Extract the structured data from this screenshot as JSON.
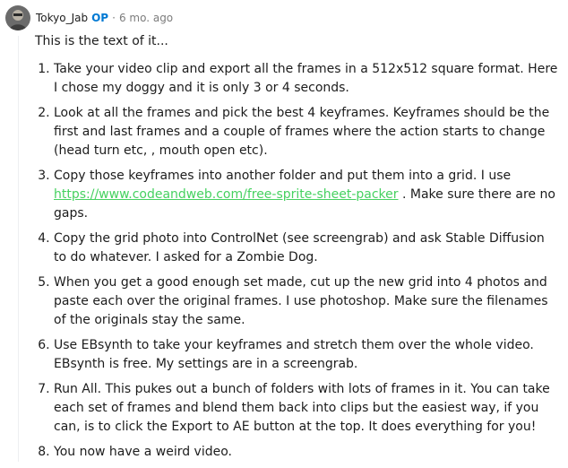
{
  "comment": {
    "author": "Tokyo_Jab",
    "badge": "OP",
    "separator": "·",
    "time": "6 mo. ago",
    "intro": "This is the text of it...",
    "steps": [
      {
        "text": "Take your video clip and export all the frames in a 512x512 square format. Here I chose my doggy and it is only 3 or 4 seconds."
      },
      {
        "text": "Look at all the frames and pick the best 4 keyframes. Keyframes should be the first and last frames and a couple of frames where the action starts to change (head turn etc, , mouth open etc)."
      },
      {
        "before": "Copy those keyframes into another folder and put them into a grid. I use ",
        "link": "https://www.codeandweb.com/free-sprite-sheet-packer",
        "after": " . Make sure there are no gaps."
      },
      {
        "text": "Copy the grid photo into ControlNet (see screengrab) and ask Stable Diffusion to do whatever. I asked for a Zombie Dog."
      },
      {
        "text": "When you get a good enough set made, cut up the new grid into 4 photos and paste each over the original frames. I use photoshop. Make sure the filenames of the originals stay the same."
      },
      {
        "text": "Use EBsynth to take your keyframes and stretch them over the whole video. EBsynth is free. My settings are in a screengrab."
      },
      {
        "text": "Run All. This pukes out a bunch of folders with lots of frames in it. You can take each set of frames and blend them back into clips but the easiest way, if you can, is to click the Export to AE button at the top. It does everything for you!"
      },
      {
        "text": "You now have a weird video."
      }
    ]
  },
  "colors": {
    "op": "#0079d3",
    "link": "#46d160",
    "meta": "#7c7c7c"
  }
}
